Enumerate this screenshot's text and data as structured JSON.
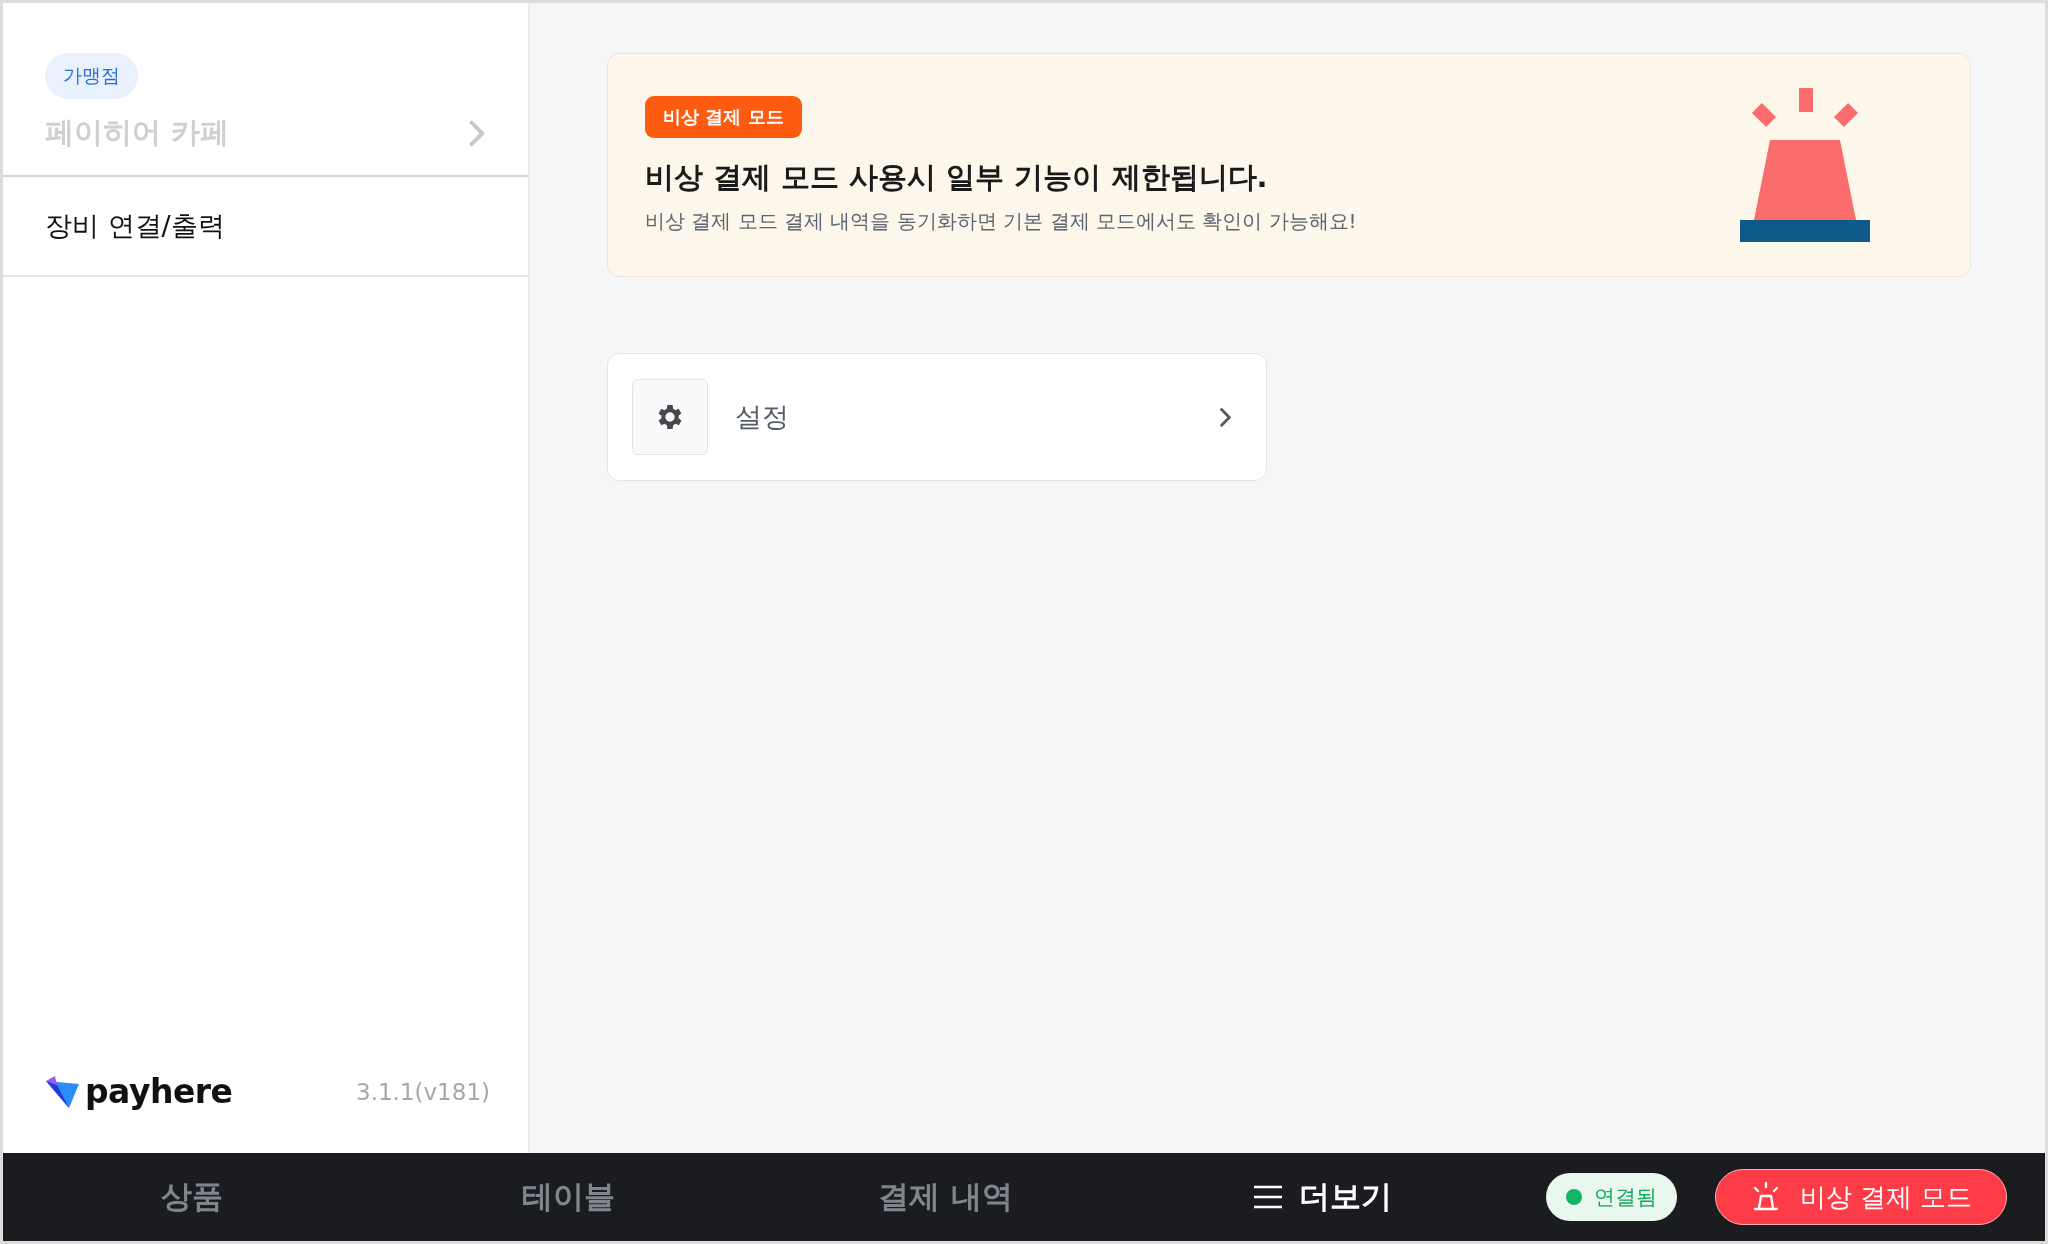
{
  "sidebar": {
    "store_badge": "가맹점",
    "store_name": "페이히어 카페",
    "items": [
      {
        "label": "장비 연결/출력"
      }
    ],
    "logo_text": "payhere",
    "version": "3.1.1(v181)"
  },
  "banner": {
    "tag": "비상 결제 모드",
    "title": "비상 결제 모드 사용시 일부 기능이 제한됩니다.",
    "description": "비상 결제 모드 결제 내역을 동기화하면 기본 결제 모드에서도 확인이 가능해요!"
  },
  "menu_cards": [
    {
      "label": "설정"
    }
  ],
  "bottom_nav": {
    "tabs": [
      {
        "label": "상품",
        "selected": false,
        "kind": "plain"
      },
      {
        "label": "테이블",
        "selected": false,
        "kind": "plain"
      },
      {
        "label": "결제 내역",
        "selected": false,
        "kind": "plain"
      },
      {
        "label": "더보기",
        "selected": true,
        "kind": "menu"
      }
    ],
    "status": {
      "label": "연결됨",
      "color": "#12b564"
    },
    "emergency_button": "비상 결제 모드"
  }
}
